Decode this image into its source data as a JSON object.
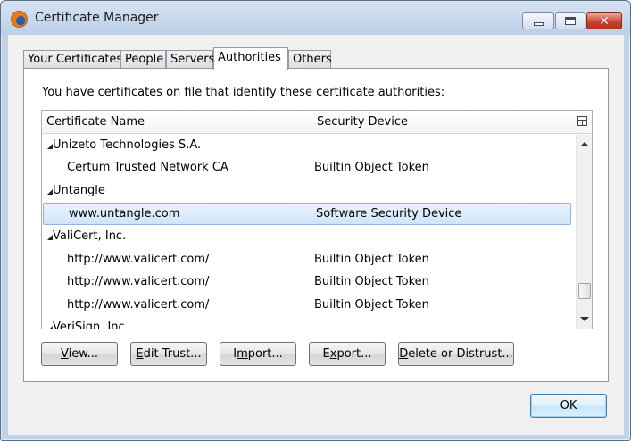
{
  "window": {
    "title": "Certificate Manager",
    "accent_color": "#c2d3e8",
    "close_color": "#c7432f"
  },
  "tabs": [
    {
      "label": "Your Certificates",
      "active": false
    },
    {
      "label": "People",
      "active": false
    },
    {
      "label": "Servers",
      "active": false
    },
    {
      "label": "Authorities",
      "active": true
    },
    {
      "label": "Others",
      "active": false
    }
  ],
  "panel": {
    "intro": "You have certificates on file that identify these certificate authorities:"
  },
  "tree": {
    "columns": [
      "Certificate Name",
      "Security Device"
    ],
    "rows": [
      {
        "type": "group",
        "name": "Unizeto Technologies S.A.",
        "device": ""
      },
      {
        "type": "child",
        "name": "Certum Trusted Network CA",
        "device": "Builtin Object Token"
      },
      {
        "type": "group",
        "name": "Untangle",
        "device": ""
      },
      {
        "type": "child",
        "name": "www.untangle.com",
        "device": "Software Security Device",
        "selected": true
      },
      {
        "type": "group",
        "name": "ValiCert, Inc.",
        "device": ""
      },
      {
        "type": "child",
        "name": "http://www.valicert.com/",
        "device": "Builtin Object Token"
      },
      {
        "type": "child",
        "name": "http://www.valicert.com/",
        "device": "Builtin Object Token"
      },
      {
        "type": "child",
        "name": "http://www.valicert.com/",
        "device": "Builtin Object Token"
      },
      {
        "type": "group",
        "name": "VeriSign, Inc.",
        "device": "",
        "cutoff": true
      }
    ],
    "selected_color": "#d0e4f8"
  },
  "buttons": {
    "view": {
      "mnemonic": "V",
      "rest": "iew..."
    },
    "edit_trust": {
      "mnemonic": "E",
      "rest": "dit Trust..."
    },
    "import": {
      "pre": "I",
      "mnemonic": "m",
      "rest": "port..."
    },
    "export": {
      "pre": "E",
      "mnemonic": "x",
      "rest": "port..."
    },
    "delete": {
      "mnemonic": "D",
      "rest": "elete or Distrust..."
    },
    "ok": "OK"
  },
  "icons": {
    "app": "firefox-icon",
    "minimize": "minimize-icon",
    "maximize": "maximize-icon",
    "close": "close-icon",
    "column_picker": "column-picker-icon"
  }
}
